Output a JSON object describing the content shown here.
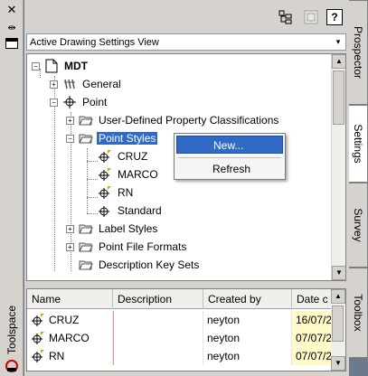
{
  "window": {
    "title": "Toolspace",
    "close_glyph": "✕",
    "pin_glyph": "⇹",
    "properties_icon": "properties-icon"
  },
  "toolbar": {
    "buttons": [
      {
        "name": "item-view-toggle-icon",
        "glyph": "⊞"
      },
      {
        "name": "disabled-toolbar-icon",
        "glyph": "▦"
      },
      {
        "name": "help-icon",
        "glyph": "?"
      }
    ]
  },
  "view_selector": {
    "value": "Active Drawing Settings View",
    "arrow": "▾"
  },
  "tree": {
    "root": "MDT",
    "general": "General",
    "point": "Point",
    "udp_classifications": "User-Defined Property Classifications",
    "point_styles": "Point Styles",
    "style_items": [
      "CRUZ",
      "MARCO",
      "RN",
      "Standard"
    ],
    "label_styles": "Label Styles",
    "point_file_formats": "Point File Formats",
    "description_key_sets": "Description Key Sets",
    "expander_plus": "+",
    "expander_minus": "−"
  },
  "context_menu": {
    "items": [
      {
        "label": "New...",
        "highlighted": true
      },
      {
        "label": "Refresh",
        "highlighted": false
      }
    ]
  },
  "list": {
    "columns": [
      "Name",
      "Description",
      "Created by",
      "Date c"
    ],
    "rows": [
      {
        "name": "CRUZ",
        "description": "",
        "created_by": "neyton",
        "date": "16/07/2"
      },
      {
        "name": "MARCO",
        "description": "",
        "created_by": "neyton",
        "date": "07/07/2"
      },
      {
        "name": "RN",
        "description": "",
        "created_by": "neyton",
        "date": "07/07/2"
      }
    ]
  },
  "right_tabs": [
    {
      "label": "Prospector",
      "active": false
    },
    {
      "label": "Settings",
      "active": true
    },
    {
      "label": "Survey",
      "active": false
    },
    {
      "label": "Toolbox",
      "active": false
    }
  ],
  "scroll_arrows": {
    "up": "▲",
    "down": "▼"
  },
  "colors": {
    "selection": "#316ac5",
    "panel": "#d6d3ce",
    "date_cell": "#fffac8"
  }
}
